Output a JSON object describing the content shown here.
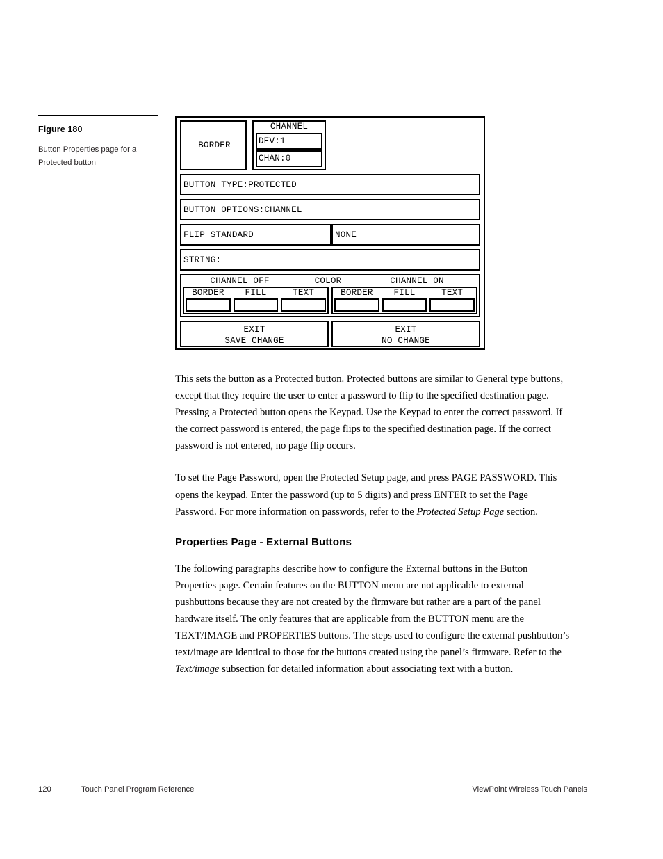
{
  "figure": {
    "number_label": "Figure 180",
    "caption": "Button Properties page for a Protected button"
  },
  "panel": {
    "border_preview_label": "BORDER",
    "channel": {
      "title": "CHANNEL",
      "device_field": "DEV:1",
      "channel_field": "CHAN:0"
    },
    "button_type_row": "BUTTON TYPE:PROTECTED",
    "button_options_row": "BUTTON OPTIONS:CHANNEL",
    "flip_row": {
      "left_label": "FLIP STANDARD",
      "right_label": "NONE"
    },
    "string_row": "STRING:",
    "color_section": {
      "header_off": "CHANNEL OFF",
      "header_middle": "COLOR",
      "header_on": "CHANNEL ON",
      "off_swatches": [
        {
          "label": "BORDER",
          "color": "#ffffff"
        },
        {
          "label": "FILL",
          "color": "#ffffff"
        },
        {
          "label": "TEXT",
          "color": "#ffffff"
        }
      ],
      "on_swatches": [
        {
          "label": "BORDER",
          "color": "#ffffff"
        },
        {
          "label": "FILL",
          "color": "#ffffff"
        },
        {
          "label": "TEXT",
          "color": "#ffffff"
        }
      ]
    },
    "exit_buttons": [
      {
        "line1": "EXIT",
        "line2": "SAVE CHANGE"
      },
      {
        "line1": "EXIT",
        "line2": "NO CHANGE"
      }
    ]
  },
  "content": {
    "paragraph_1": "This sets the button as a Protected button. Protected buttons are similar to General type buttons, except that they require the user to enter a password to flip to the specified destination page. Pressing a Protected button opens the Keypad. Use the Keypad to enter the correct password. If the correct password is entered, the page flips to the specified destination page. If the correct password is not entered, no page flip occurs.",
    "paragraph_2_part1": "To set the Page Password, open the Protected Setup page, and press PAGE PASSWORD. This opens the keypad. Enter the password (up to 5 digits) and press ENTER to set the Page Password. For more information on passwords, refer to the ",
    "paragraph_2_italic": "Protected Setup Page",
    "paragraph_2_part2": " section.",
    "section_heading": "Properties Page - External Buttons",
    "paragraph_3_part1": "The following paragraphs describe how to configure the External buttons in the Button Properties page. Certain features on the BUTTON menu are not applicable to external pushbuttons because they are not created by the firmware but rather are a part of the panel hardware itself. The only features that are applicable from the BUTTON menu are the TEXT/IMAGE and PROPERTIES buttons. The steps used to configure the external pushbutton’s text/image are identical to those for the buttons created using the panel’s firmware. Refer to the ",
    "paragraph_3_italic": "Text/image",
    "paragraph_3_part2": " subsection for detailed information about associating text with a button."
  },
  "footer": {
    "page_number": "120",
    "left_label": "Touch Panel Program Reference",
    "right_label": "ViewPoint Wireless Touch Panels"
  }
}
